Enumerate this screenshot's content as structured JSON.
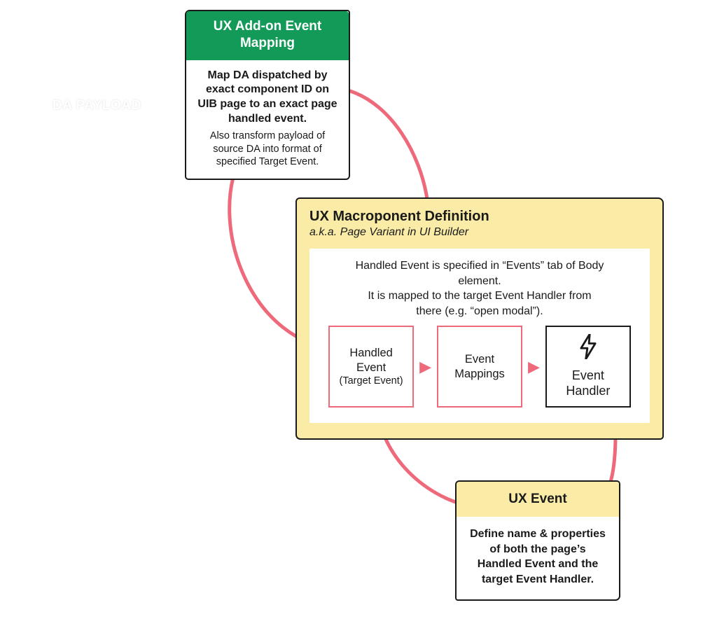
{
  "labels": {
    "da_payload": "DA PAYLOAD"
  },
  "addon": {
    "title": "UX Add-on Event Mapping",
    "main": "Map DA dispatched by exact component ID on UIB page to an exact page handled event.",
    "sub": "Also transform payload of source DA into format of specified Target Event."
  },
  "macro": {
    "title": "UX Macroponent Definition",
    "subtitle": "a.k.a. Page Variant in UI Builder",
    "description": "Handled Event is specified in “Events” tab of Body element.\nIt is mapped to the target Event Handler from there (e.g. “open modal”).",
    "handled_event": {
      "label": "Handled Event",
      "sub": "(Target Event)"
    },
    "event_mappings": "Event Mappings",
    "event_handler": "Event Handler"
  },
  "ux_event": {
    "title": "UX Event",
    "body": "Define name & properties of both the page’s Handled Event and the target Event Handler."
  }
}
